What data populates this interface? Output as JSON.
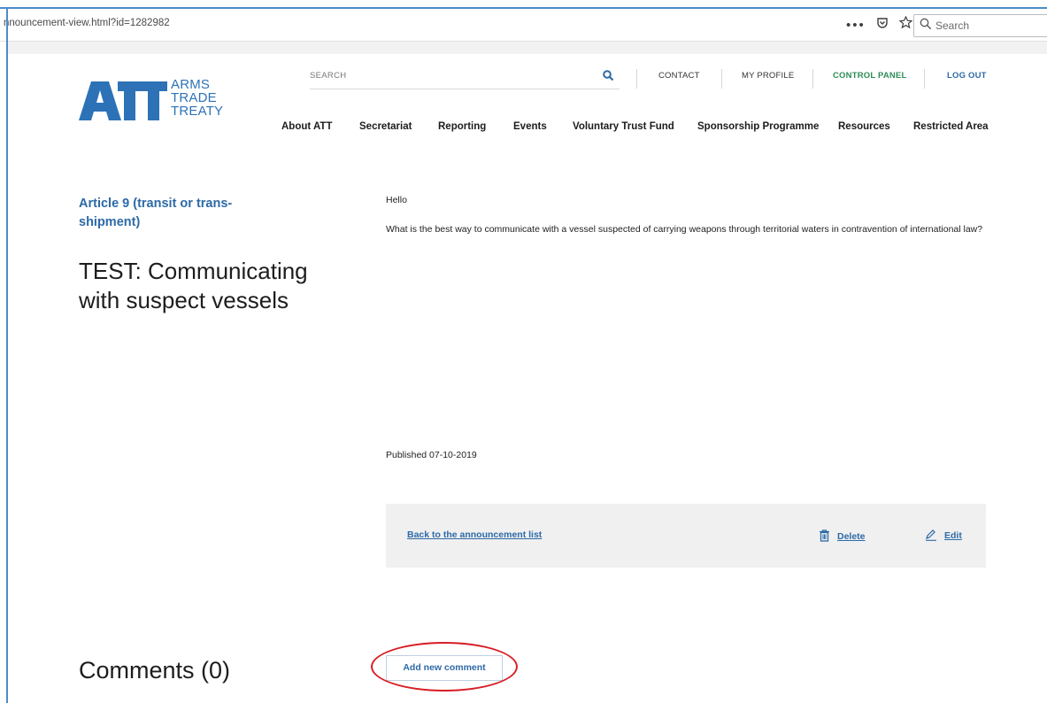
{
  "browser": {
    "url": "nnouncement-view.html?id=1282982",
    "search_placeholder": "Search"
  },
  "logo": {
    "letters": "ATT",
    "line1": "ARMS",
    "line2": "TRADE",
    "line3": "TREATY"
  },
  "utility": {
    "search_label": "SEARCH",
    "contact": "CONTACT",
    "my_profile": "MY PROFILE",
    "control_panel": "CONTROL PANEL",
    "log_out": "LOG OUT"
  },
  "nav": {
    "items": [
      "About ATT",
      "Secretariat",
      "Reporting",
      "Events",
      "Voluntary Trust Fund",
      "Sponsorship Programme",
      "Resources",
      "Restricted Area"
    ]
  },
  "announcement": {
    "category": "Article 9 (transit or trans-shipment)",
    "title": "TEST: Communicating with suspect vessels",
    "greeting": "Hello",
    "body": "What is the best way to communicate with a vessel suspected of carrying weapons through territorial waters in contravention of international law?",
    "published": "Published 07-10-2019"
  },
  "actions": {
    "back": "Back to the announcement list",
    "delete": "Delete",
    "edit": "Edit"
  },
  "comments": {
    "heading": "Comments (0)",
    "add_button": "Add new comment"
  },
  "colors": {
    "brand_blue": "#2d6aa6",
    "control_panel_green": "#2e8b57",
    "highlight_red": "#d81c23"
  }
}
